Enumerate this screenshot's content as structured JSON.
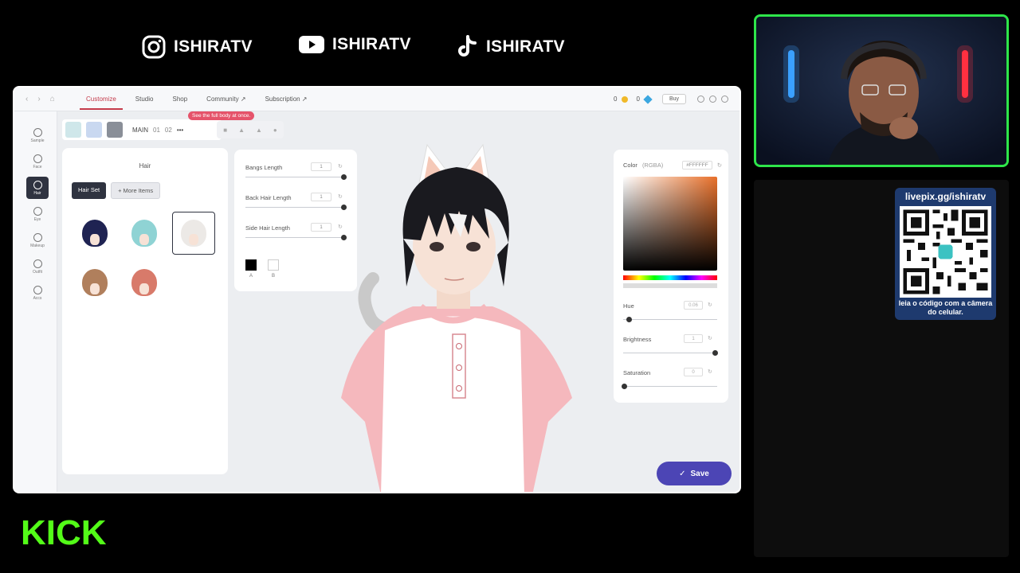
{
  "social": {
    "instagram": "ISHIRATV",
    "youtube": "ISHIRATV",
    "tiktok": "ISHIRATV"
  },
  "topbar": {
    "tabs": [
      "Customize",
      "Studio",
      "Shop",
      "Community ↗",
      "Subscription ↗"
    ],
    "coins": "0",
    "gems": "0",
    "buy": "Buy"
  },
  "rail": [
    "Sample",
    "Face",
    "Hair",
    "Eye",
    "Makeup",
    "Outfit",
    "Accs"
  ],
  "subbar": {
    "main": "MAIN",
    "slot1": "01",
    "slot2": "02",
    "more": "•••",
    "tooltip": "See the full body at once."
  },
  "hair_panel": {
    "title": "Hair",
    "hair_set": "Hair Set",
    "more_items": "+ More Items",
    "styles": [
      {
        "name": "navy-hair",
        "color": "#1f2352"
      },
      {
        "name": "mint-hair",
        "color": "#8fd3d4"
      },
      {
        "name": "white-hair",
        "color": "#ece9e6"
      },
      {
        "name": "brown-hair",
        "color": "#b07f5c"
      },
      {
        "name": "pink-orange-hair",
        "color": "#d87a6a"
      }
    ]
  },
  "sliders": {
    "bangs": {
      "label": "Bangs Length",
      "value": "1"
    },
    "back": {
      "label": "Back Hair Length",
      "value": "1"
    },
    "side": {
      "label": "Side Hair Length",
      "value": "1"
    },
    "swatch_a": "A",
    "swatch_b": "B"
  },
  "color_panel": {
    "title": "Color",
    "mode": "(RGBA)",
    "hex": "#FFFFFF",
    "hue": {
      "label": "Hue",
      "value": "0.06"
    },
    "brightness": {
      "label": "Brightness",
      "value": "1"
    },
    "saturation": {
      "label": "Saturation",
      "value": "0"
    }
  },
  "save": "Save",
  "qr": {
    "url": "livepix.gg/ishiratv",
    "caption": "leia o código com a câmera do celular."
  },
  "kick": "KICK"
}
